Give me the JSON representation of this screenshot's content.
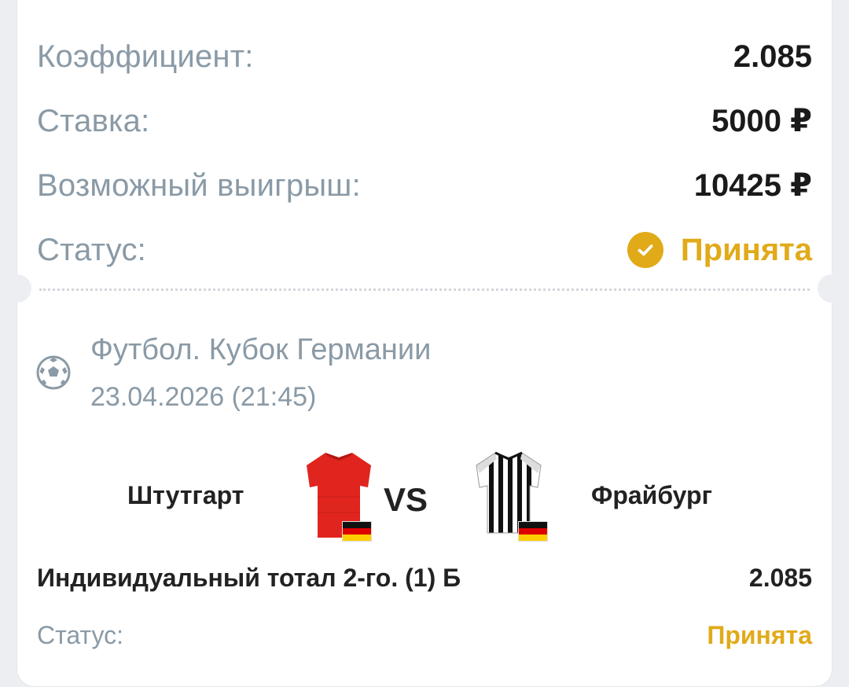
{
  "summary": {
    "coefficient": {
      "label": "Коэффициент:",
      "value": "2.085"
    },
    "stake": {
      "label": "Ставка:",
      "value": "5000 ₽"
    },
    "possible_win": {
      "label": "Возможный выигрыш:",
      "value": "10425 ₽"
    },
    "status": {
      "label": "Статус:",
      "value": "Принята"
    }
  },
  "event": {
    "league": "Футбол. Кубок Германии",
    "datetime": "23.04.2026 (21:45)",
    "home_team": "Штутгарт",
    "away_team": "Фрайбург",
    "vs": "VS",
    "home_country": "Germany",
    "away_country": "Germany"
  },
  "selection": {
    "market": "Индивидуальный тотал 2-го. (1) Б",
    "odds": "2.085",
    "status_label": "Статус:",
    "status_value": "Принята"
  },
  "colors": {
    "accent": "#e1aa19",
    "muted": "#8a9aa6",
    "text": "#222222",
    "home_jersey": "#e0251f"
  },
  "icons": {
    "status": "check-circle-icon",
    "sport": "soccer-ball-icon"
  }
}
